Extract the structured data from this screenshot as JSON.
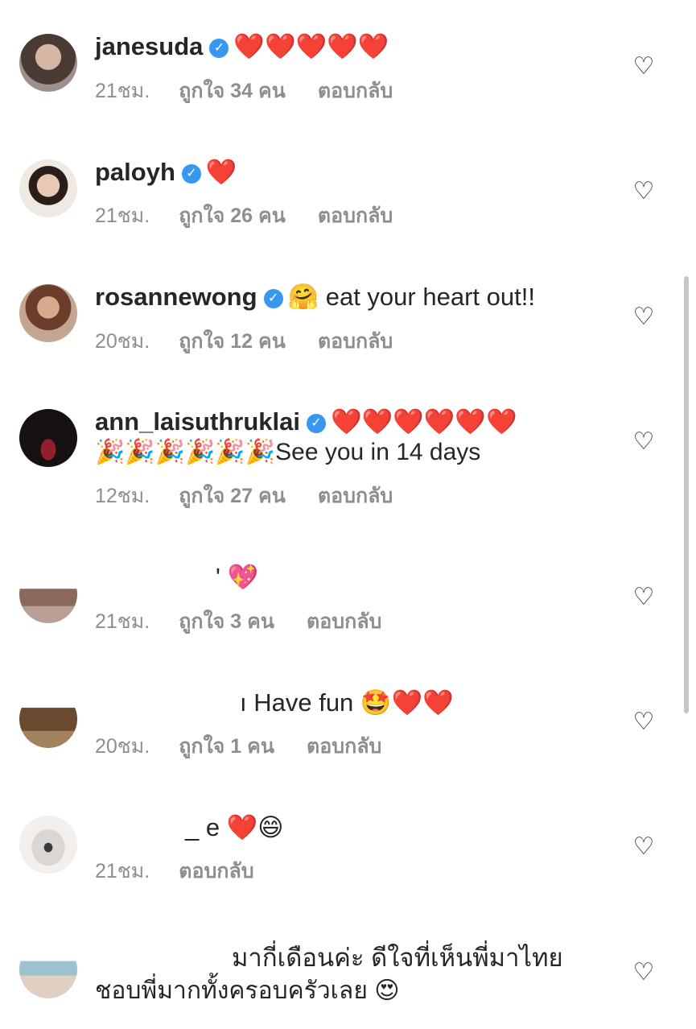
{
  "comments": [
    {
      "username": "janesuda",
      "text": "❤️❤️❤️❤️❤️",
      "time": "21ชม.",
      "likes": "ถูกใจ 34 คน",
      "reply": "ตอบกลับ"
    },
    {
      "username": "paloyh",
      "text": "❤️",
      "time": "21ชม.",
      "likes": "ถูกใจ 26 คน",
      "reply": "ตอบกลับ"
    },
    {
      "username": "rosannewong",
      "text": "🤗 eat your heart out!!",
      "time": "20ชม.",
      "likes": "ถูกใจ 12 คน",
      "reply": "ตอบกลับ"
    },
    {
      "username": "ann_laisuthruklai",
      "text": "❤️❤️❤️❤️❤️❤️",
      "text2": "🎉🎉🎉🎉🎉🎉See you in 14 days",
      "time": "12ชม.",
      "likes": "ถูกใจ 27 คน",
      "reply": "ตอบกลับ"
    },
    {
      "username": "",
      "text": "' 💖",
      "time": "21ชม.",
      "likes": "ถูกใจ 3 คน",
      "reply": "ตอบกลับ"
    },
    {
      "username": "",
      "text": "ı Have fun 🤩❤️❤️",
      "time": "20ชม.",
      "likes": "ถูกใจ 1 คน",
      "reply": "ตอบกลับ"
    },
    {
      "username": "",
      "text": "_ e ❤️😄",
      "time": "21ชม.",
      "reply": "ตอบกลับ"
    },
    {
      "username": "",
      "text": "มากี่เดือนค่ะ ดีใจที่เห็นพี่มาไทย",
      "text2": "ชอบพี่มากทั้งครอบครัวเลย 😍"
    }
  ],
  "icons": {
    "like": "heart-outline-icon",
    "verified": "verified-badge-icon"
  },
  "colors": {
    "text": "#262626",
    "meta": "#8e8e8e",
    "verified": "#3897f0"
  },
  "badge_glyph": "✓",
  "heart_glyph": "♡"
}
